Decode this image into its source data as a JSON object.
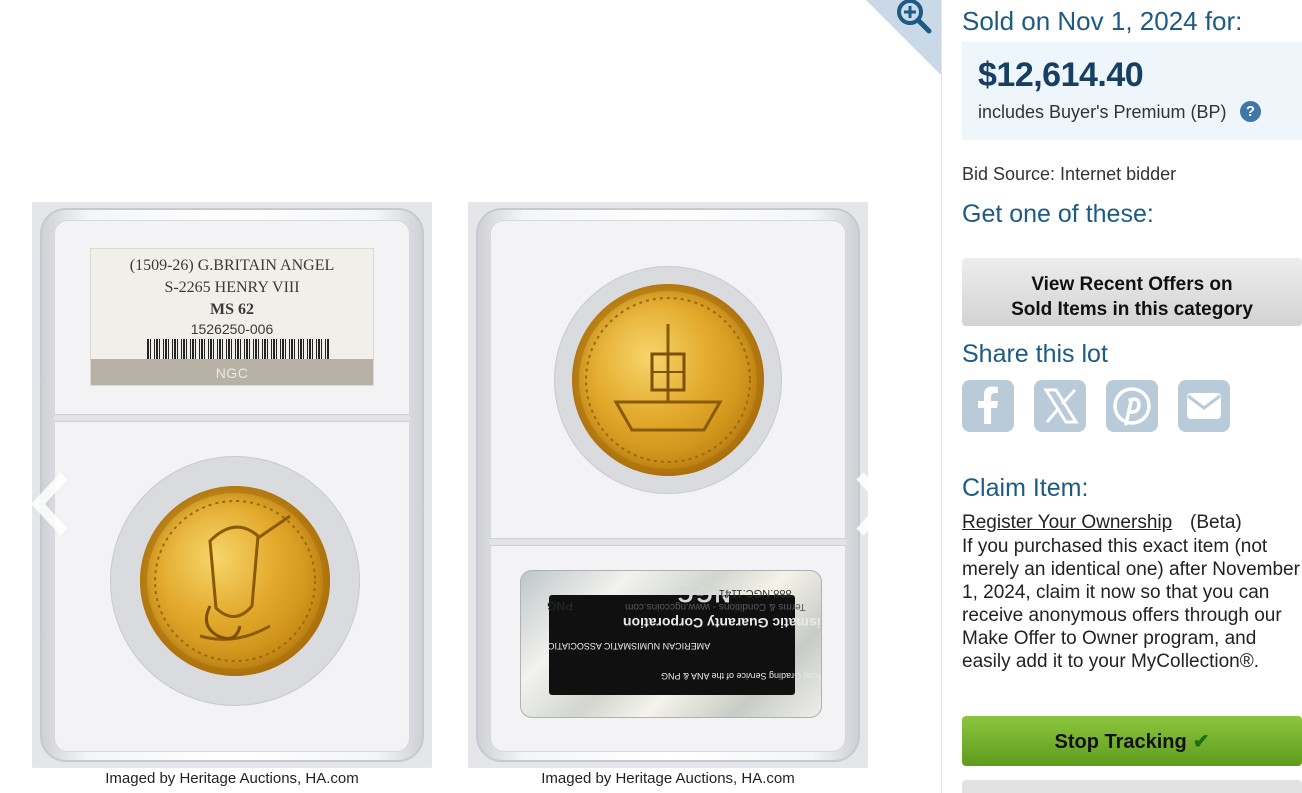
{
  "gallery": {
    "left_image": {
      "label_line1": "(1509-26) G.BRITAIN ANGEL",
      "label_line2": "S-2265 HENRY VIII",
      "label_grade": "MS 62",
      "label_cert": "1526250-006",
      "label_brand": "NGC"
    },
    "right_image": {
      "sticker_title": "Numismatic Guaranty Corporation",
      "sticker_sub": "Terms & Conditions - www.ngccoins.com",
      "sticker_phone": "888.NGC.1141",
      "sticker_logo": "NGC",
      "sticker_service": "The Official Grading Service of the ANA & PNG",
      "sticker_assoc": "AMERICAN NUMISMATIC ASSOCIATION",
      "sticker_png": "PNG"
    },
    "caption_left": "Imaged by Heritage Auctions, HA.com",
    "caption_right": "Imaged by Heritage Auctions, HA.com",
    "icons": {
      "zoom": "zoom-in-icon",
      "prev": "chevron-left-icon",
      "next": "chevron-right-icon"
    }
  },
  "sale": {
    "sold_heading": "Sold on Nov 1, 2024 for:",
    "price": "$12,614.40",
    "bp_text": "includes Buyer's Premium (BP)",
    "help_glyph": "?",
    "bid_source": "Bid Source: Internet bidder"
  },
  "get_one": {
    "heading": "Get one of these:",
    "button_line1": "View Recent Offers on",
    "button_line2": "Sold Items in this category"
  },
  "share": {
    "heading": "Share this lot",
    "buttons": [
      "facebook-icon",
      "x-icon",
      "pinterest-icon",
      "email-icon"
    ]
  },
  "claim": {
    "heading": "Claim Item:",
    "link": "Register Your Ownership",
    "beta": "(Beta)",
    "body": "If you purchased this exact item (not merely an identical one) after November 1, 2024, claim it now so that you can receive anonymous offers through our Make Offer to Owner program, and easily add it to your MyCollection®."
  },
  "tracking": {
    "button_label": "Stop Tracking",
    "check_glyph": "✔"
  },
  "colors": {
    "heading_blue": "#1d5a84",
    "price_navy": "#173f63",
    "price_box_bg": "#eef5fb",
    "share_icon_bg": "#b9cad8",
    "tracking_green": "#6aa827"
  }
}
